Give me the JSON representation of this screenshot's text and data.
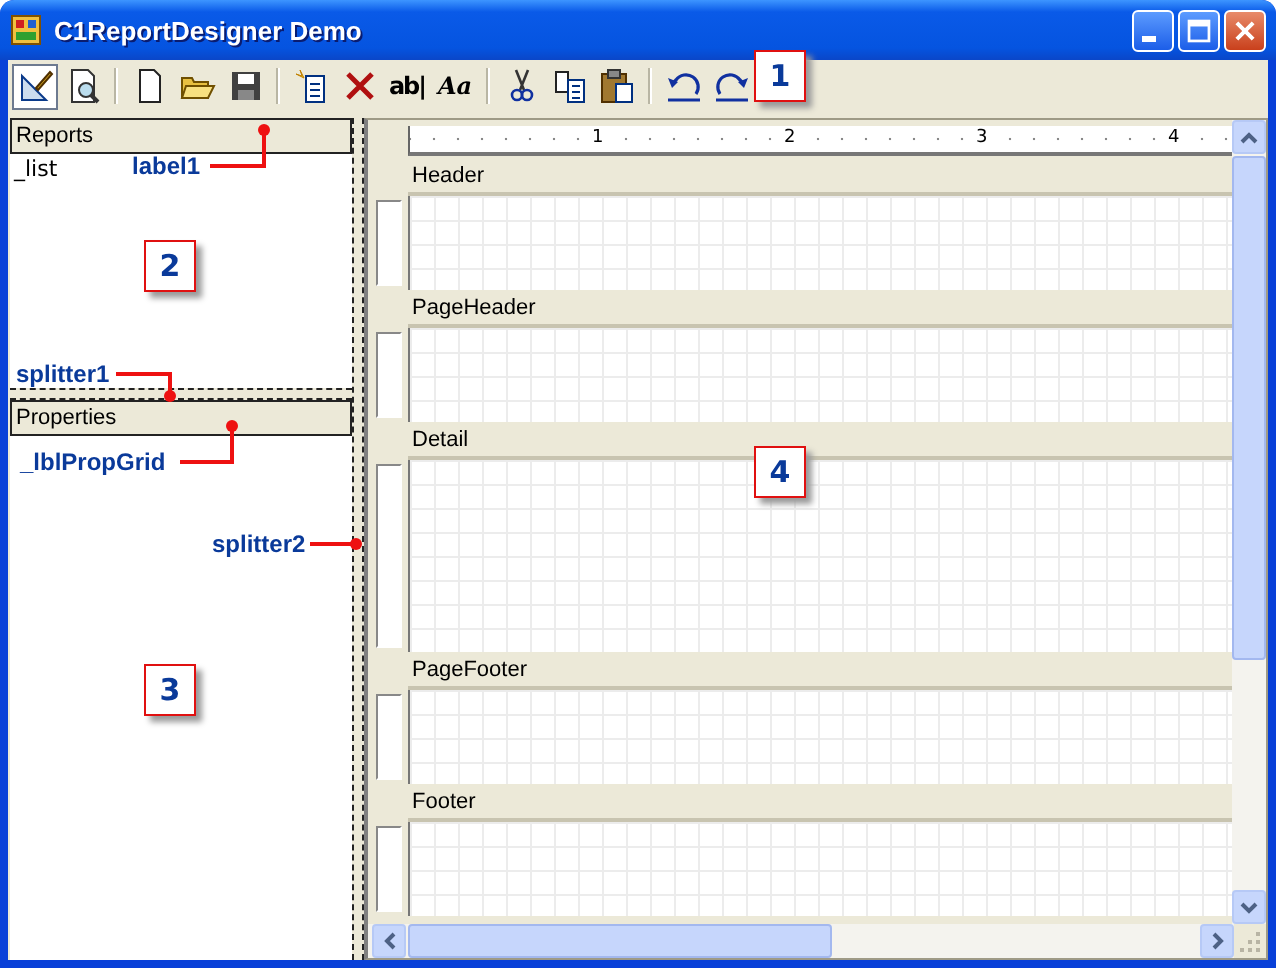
{
  "window": {
    "title": "C1ReportDesigner Demo"
  },
  "toolbar": [
    {
      "kind": "design",
      "pressed": true
    },
    {
      "kind": "preview",
      "pressed": false
    },
    {
      "kind": "sep"
    },
    {
      "kind": "new",
      "pressed": false
    },
    {
      "kind": "open",
      "pressed": false
    },
    {
      "kind": "save",
      "pressed": false
    },
    {
      "kind": "sep"
    },
    {
      "kind": "add",
      "pressed": false
    },
    {
      "kind": "delete",
      "pressed": false
    },
    {
      "kind": "glyph",
      "label": "ab|",
      "pressed": false
    },
    {
      "kind": "glyph-italic",
      "label": "Aa",
      "pressed": false
    },
    {
      "kind": "sep"
    },
    {
      "kind": "cut",
      "pressed": false
    },
    {
      "kind": "copy",
      "pressed": false
    },
    {
      "kind": "paste",
      "pressed": false
    },
    {
      "kind": "sep"
    },
    {
      "kind": "undo",
      "pressed": false
    },
    {
      "kind": "redo",
      "pressed": false
    }
  ],
  "reports": {
    "header": "Reports",
    "items": [
      "_list"
    ]
  },
  "properties": {
    "header": "Properties"
  },
  "ruler": {
    "ticks": [
      "1",
      "2",
      "3",
      "4"
    ]
  },
  "sections": [
    {
      "name": "Header",
      "tall": false
    },
    {
      "name": "PageHeader",
      "tall": false
    },
    {
      "name": "Detail",
      "tall": true
    },
    {
      "name": "PageFooter",
      "tall": false
    },
    {
      "name": "Footer",
      "tall": false
    }
  ],
  "callouts": [
    {
      "kind": "number",
      "text": "1"
    },
    {
      "kind": "tag",
      "text": "label1"
    },
    {
      "kind": "number",
      "text": "2"
    },
    {
      "kind": "tag",
      "text": "splitter1"
    },
    {
      "kind": "tag",
      "text": "_lblPropGrid"
    },
    {
      "kind": "tag",
      "text": "splitter2"
    },
    {
      "kind": "number",
      "text": "3"
    },
    {
      "kind": "number",
      "text": "4"
    }
  ]
}
